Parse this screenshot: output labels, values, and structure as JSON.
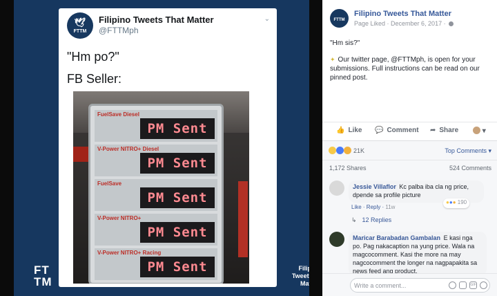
{
  "viewer": {
    "tweet": {
      "name": "Filipino Tweets That Matter",
      "handle": "@FTTMph",
      "avatar_text": "FTTM",
      "line1": "\"Hm po?\"",
      "line2": "FB Seller:",
      "sign_labels": [
        "FuelSave Diesel",
        "V-Power NITRO+ Diesel",
        "FuelSave",
        "V-Power NITRO+",
        "V-Power NITRO+ Racing"
      ],
      "led_text": "PM Sent"
    },
    "logo_line1": "FT",
    "logo_line2": "TM",
    "tagline": "Filipino Tweets That Matter"
  },
  "page": {
    "avatar_text": "FTTM",
    "name": "Filipino Tweets That Matter",
    "meta": "Page Liked · December 6, 2017 ·"
  },
  "post": {
    "text1": "\"Hm sis?\"",
    "text2": "Our twitter page, @FTTMph, is open for your submissions. Full instructions can be read on our pinned post."
  },
  "actions": {
    "like": "Like",
    "comment": "Comment",
    "share": "Share"
  },
  "reactions": {
    "count": "21K",
    "top_comments": "Top Comments"
  },
  "counts": {
    "shares": "1,172 Shares",
    "comments": "524 Comments"
  },
  "comments": [
    {
      "author": "Jessie Villaflor",
      "text": "Kc palba iba cla ng price, dpende sa profile picture",
      "reaction_count": "190",
      "like": "Like",
      "reply": "Reply",
      "time": "11w",
      "replies": "12 Replies"
    },
    {
      "author": "Maricar Barabadan Gambalan",
      "text": "E kasi nga po. Pag nakacaption na yung price. Wala na magcocomment. Kasi the more na may nagcocomment the longer na nagpapakita sa news feed ang product."
    }
  ],
  "composer": {
    "placeholder": "Write a comment..."
  },
  "icons": {
    "like": "thumbs-up-icon",
    "comment": "comment-bubble-icon",
    "share": "share-arrow-icon",
    "globe": "globe-icon"
  }
}
